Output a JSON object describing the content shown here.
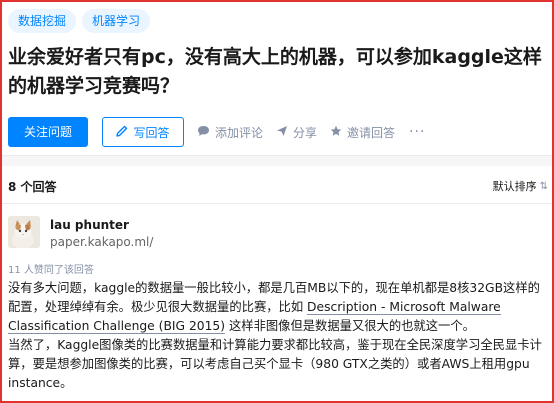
{
  "question": {
    "topics": [
      "数据挖掘",
      "机器学习"
    ],
    "title": "业余爱好者只有pc，没有高大上的机器，可以参加kaggle这样的机器学习竞赛吗？",
    "actions": {
      "follow": "关注问题",
      "write": "写回答",
      "comment": "添加评论",
      "share": "分享",
      "invite": "邀请回答",
      "more": "···"
    }
  },
  "answers": {
    "count": "8 个回答",
    "sort": "默认排序",
    "first": {
      "author": "lau phunter",
      "headline": "paper.kakapo.ml/",
      "votes": "11 人赞同了该回答",
      "p1_before": "没有多大问题，kaggle的数据量一般比较小，都是几百MB以下的，现在单机都是8核32GB这样的配置，处理绰绰有余。极少见很大数据量的比赛，比如 ",
      "p1_link": "Description - Microsoft Malware Classification Challenge (BIG 2015)",
      "p1_after": " 这样非图像但是数据量又很大的也就这一个。",
      "p2": "当然了，Kaggle图像类的比赛数据量和计算能力要求都比较高，鉴于现在全民深度学习全民显卡计算，要是想参加图像类的比赛，可以考虑自己买个显卡（980 GTX之类的）或者AWS上租用gpu instance。"
    }
  },
  "colors": {
    "accent": "#0084ff",
    "frame": "#e0322f",
    "muted": "#8590a6"
  }
}
